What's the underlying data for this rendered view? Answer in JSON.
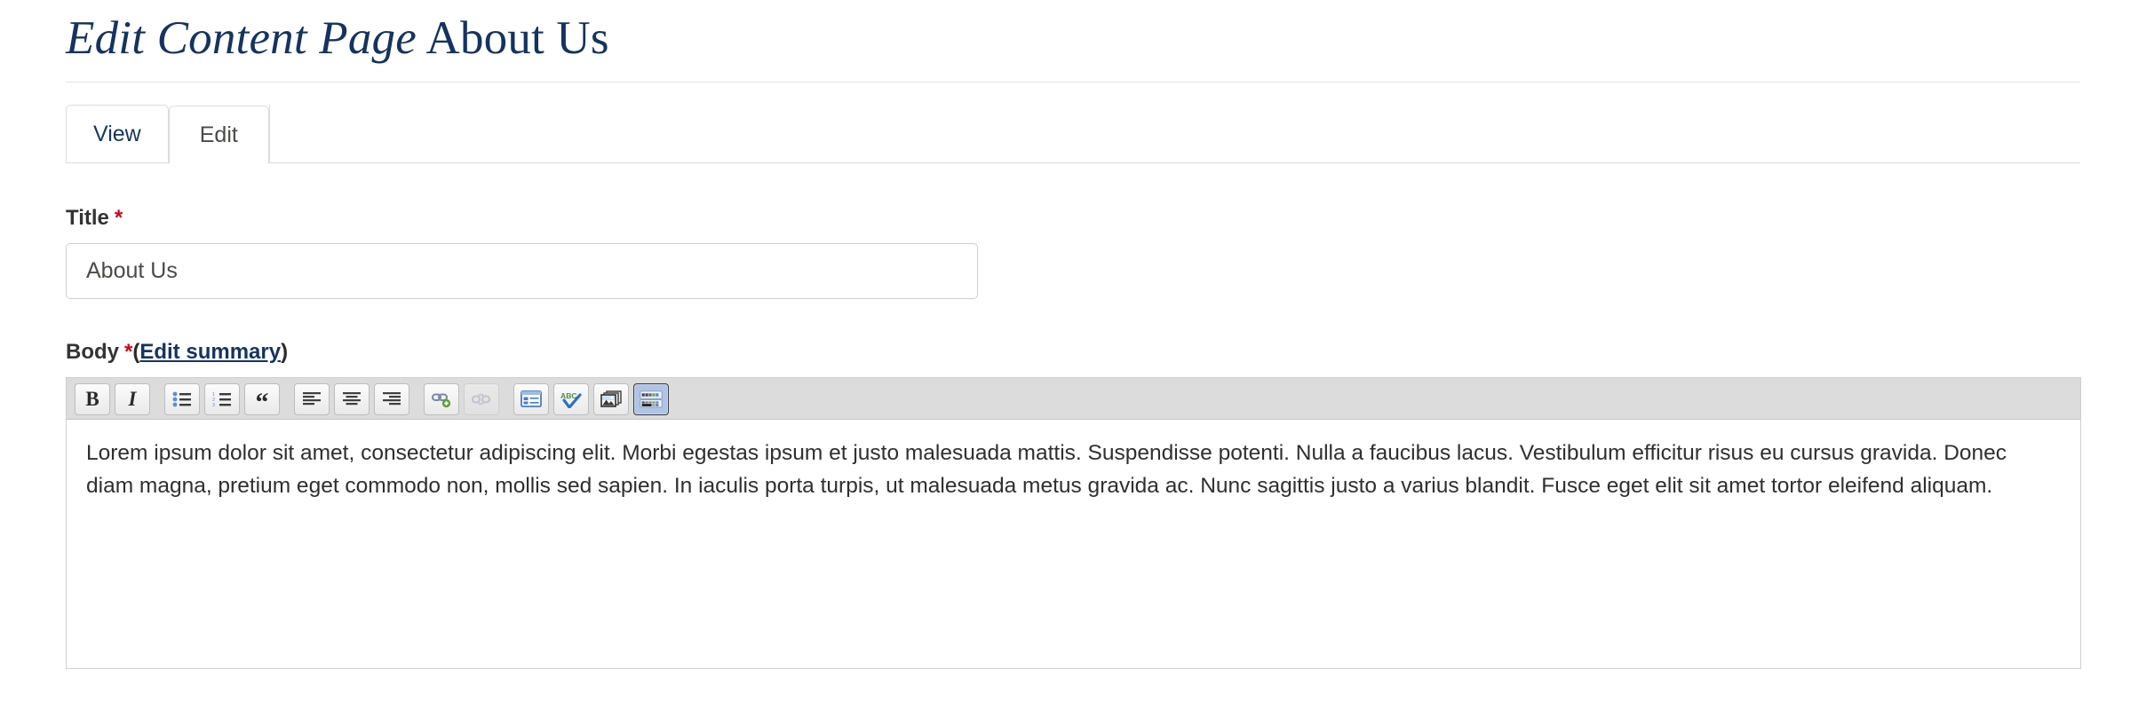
{
  "page": {
    "title_emphasis": "Edit Content Page",
    "title_plain": " About Us"
  },
  "tabs": [
    {
      "label": "View",
      "active": false
    },
    {
      "label": "Edit",
      "active": true
    }
  ],
  "form": {
    "title_field": {
      "label": "Title",
      "required_marker": "*",
      "value": "About Us",
      "placeholder": "About Us"
    },
    "body_field": {
      "label": "Body",
      "required_marker": "*",
      "paren_open": "(",
      "edit_summary_link": "Edit summary",
      "paren_close": ")",
      "content": "Lorem ipsum dolor sit amet, consectetur adipiscing elit. Morbi egestas ipsum et justo malesuada mattis. Suspendisse potenti. Nulla a faucibus lacus. Vestibulum efficitur risus eu cursus gravida. Donec diam magna, pretium eget commodo non, mollis sed sapien. In iaculis porta turpis, ut malesuada metus gravida ac. Nunc sagittis justo a varius blandit. Fusce eget elit sit amet tortor eleifend aliquam."
    }
  },
  "toolbar": {
    "buttons": [
      {
        "name": "bold",
        "label": "B",
        "icon": "bold-icon",
        "state": "normal"
      },
      {
        "name": "italic",
        "label": "I",
        "icon": "italic-icon",
        "state": "normal"
      },
      {
        "name": "bulleted-list",
        "label": "",
        "icon": "bulleted-list-icon",
        "state": "normal"
      },
      {
        "name": "numbered-list",
        "label": "",
        "icon": "numbered-list-icon",
        "state": "normal"
      },
      {
        "name": "blockquote",
        "label": "“",
        "icon": "blockquote-icon",
        "state": "normal"
      },
      {
        "name": "align-left",
        "label": "",
        "icon": "align-left-icon",
        "state": "normal"
      },
      {
        "name": "align-center",
        "label": "",
        "icon": "align-center-icon",
        "state": "normal"
      },
      {
        "name": "align-right",
        "label": "",
        "icon": "align-right-icon",
        "state": "normal"
      },
      {
        "name": "insert-link",
        "label": "",
        "icon": "link-add-icon",
        "state": "normal"
      },
      {
        "name": "unlink",
        "label": "",
        "icon": "unlink-icon",
        "state": "disabled"
      },
      {
        "name": "insert-template",
        "label": "",
        "icon": "template-icon",
        "state": "normal"
      },
      {
        "name": "spell-check",
        "label": "ABC",
        "icon": "spellcheck-abc-icon",
        "state": "normal"
      },
      {
        "name": "insert-image",
        "label": "",
        "icon": "image-icon",
        "state": "normal"
      },
      {
        "name": "show-blocks",
        "label": "",
        "icon": "color-grid-icon",
        "state": "active"
      }
    ]
  },
  "colors": {
    "title_navy": "#16335f",
    "link_navy": "#16355f",
    "required_red": "#d0021b",
    "toolbar_bg": "#dcdcdc",
    "border_gray": "#cfcfcf",
    "active_button_bg": "#aec5e8"
  }
}
